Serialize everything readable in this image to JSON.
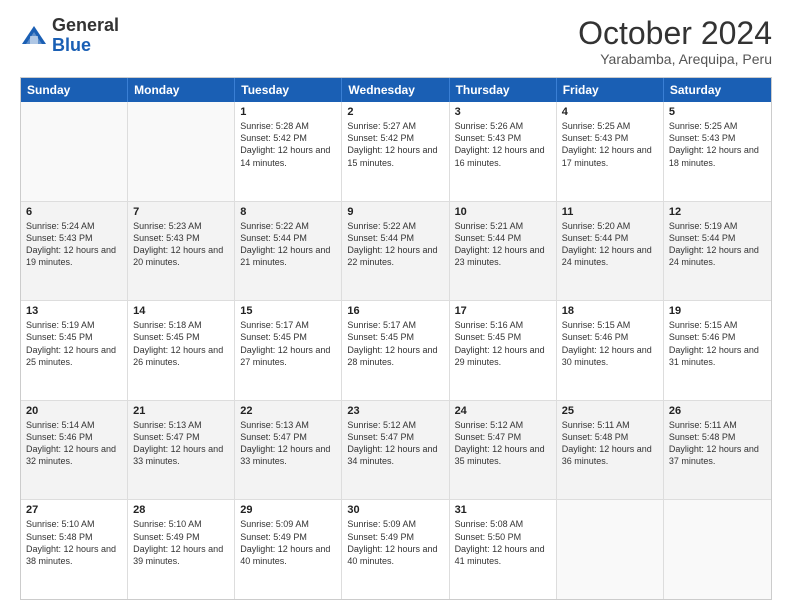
{
  "logo": {
    "general": "General",
    "blue": "Blue"
  },
  "title": "October 2024",
  "subtitle": "Yarabamba, Arequipa, Peru",
  "days": [
    "Sunday",
    "Monday",
    "Tuesday",
    "Wednesday",
    "Thursday",
    "Friday",
    "Saturday"
  ],
  "weeks": [
    [
      {
        "day": "",
        "sunrise": "",
        "sunset": "",
        "daylight": ""
      },
      {
        "day": "",
        "sunrise": "",
        "sunset": "",
        "daylight": ""
      },
      {
        "day": "1",
        "sunrise": "Sunrise: 5:28 AM",
        "sunset": "Sunset: 5:42 PM",
        "daylight": "Daylight: 12 hours and 14 minutes."
      },
      {
        "day": "2",
        "sunrise": "Sunrise: 5:27 AM",
        "sunset": "Sunset: 5:42 PM",
        "daylight": "Daylight: 12 hours and 15 minutes."
      },
      {
        "day": "3",
        "sunrise": "Sunrise: 5:26 AM",
        "sunset": "Sunset: 5:43 PM",
        "daylight": "Daylight: 12 hours and 16 minutes."
      },
      {
        "day": "4",
        "sunrise": "Sunrise: 5:25 AM",
        "sunset": "Sunset: 5:43 PM",
        "daylight": "Daylight: 12 hours and 17 minutes."
      },
      {
        "day": "5",
        "sunrise": "Sunrise: 5:25 AM",
        "sunset": "Sunset: 5:43 PM",
        "daylight": "Daylight: 12 hours and 18 minutes."
      }
    ],
    [
      {
        "day": "6",
        "sunrise": "Sunrise: 5:24 AM",
        "sunset": "Sunset: 5:43 PM",
        "daylight": "Daylight: 12 hours and 19 minutes."
      },
      {
        "day": "7",
        "sunrise": "Sunrise: 5:23 AM",
        "sunset": "Sunset: 5:43 PM",
        "daylight": "Daylight: 12 hours and 20 minutes."
      },
      {
        "day": "8",
        "sunrise": "Sunrise: 5:22 AM",
        "sunset": "Sunset: 5:44 PM",
        "daylight": "Daylight: 12 hours and 21 minutes."
      },
      {
        "day": "9",
        "sunrise": "Sunrise: 5:22 AM",
        "sunset": "Sunset: 5:44 PM",
        "daylight": "Daylight: 12 hours and 22 minutes."
      },
      {
        "day": "10",
        "sunrise": "Sunrise: 5:21 AM",
        "sunset": "Sunset: 5:44 PM",
        "daylight": "Daylight: 12 hours and 23 minutes."
      },
      {
        "day": "11",
        "sunrise": "Sunrise: 5:20 AM",
        "sunset": "Sunset: 5:44 PM",
        "daylight": "Daylight: 12 hours and 24 minutes."
      },
      {
        "day": "12",
        "sunrise": "Sunrise: 5:19 AM",
        "sunset": "Sunset: 5:44 PM",
        "daylight": "Daylight: 12 hours and 24 minutes."
      }
    ],
    [
      {
        "day": "13",
        "sunrise": "Sunrise: 5:19 AM",
        "sunset": "Sunset: 5:45 PM",
        "daylight": "Daylight: 12 hours and 25 minutes."
      },
      {
        "day": "14",
        "sunrise": "Sunrise: 5:18 AM",
        "sunset": "Sunset: 5:45 PM",
        "daylight": "Daylight: 12 hours and 26 minutes."
      },
      {
        "day": "15",
        "sunrise": "Sunrise: 5:17 AM",
        "sunset": "Sunset: 5:45 PM",
        "daylight": "Daylight: 12 hours and 27 minutes."
      },
      {
        "day": "16",
        "sunrise": "Sunrise: 5:17 AM",
        "sunset": "Sunset: 5:45 PM",
        "daylight": "Daylight: 12 hours and 28 minutes."
      },
      {
        "day": "17",
        "sunrise": "Sunrise: 5:16 AM",
        "sunset": "Sunset: 5:45 PM",
        "daylight": "Daylight: 12 hours and 29 minutes."
      },
      {
        "day": "18",
        "sunrise": "Sunrise: 5:15 AM",
        "sunset": "Sunset: 5:46 PM",
        "daylight": "Daylight: 12 hours and 30 minutes."
      },
      {
        "day": "19",
        "sunrise": "Sunrise: 5:15 AM",
        "sunset": "Sunset: 5:46 PM",
        "daylight": "Daylight: 12 hours and 31 minutes."
      }
    ],
    [
      {
        "day": "20",
        "sunrise": "Sunrise: 5:14 AM",
        "sunset": "Sunset: 5:46 PM",
        "daylight": "Daylight: 12 hours and 32 minutes."
      },
      {
        "day": "21",
        "sunrise": "Sunrise: 5:13 AM",
        "sunset": "Sunset: 5:47 PM",
        "daylight": "Daylight: 12 hours and 33 minutes."
      },
      {
        "day": "22",
        "sunrise": "Sunrise: 5:13 AM",
        "sunset": "Sunset: 5:47 PM",
        "daylight": "Daylight: 12 hours and 33 minutes."
      },
      {
        "day": "23",
        "sunrise": "Sunrise: 5:12 AM",
        "sunset": "Sunset: 5:47 PM",
        "daylight": "Daylight: 12 hours and 34 minutes."
      },
      {
        "day": "24",
        "sunrise": "Sunrise: 5:12 AM",
        "sunset": "Sunset: 5:47 PM",
        "daylight": "Daylight: 12 hours and 35 minutes."
      },
      {
        "day": "25",
        "sunrise": "Sunrise: 5:11 AM",
        "sunset": "Sunset: 5:48 PM",
        "daylight": "Daylight: 12 hours and 36 minutes."
      },
      {
        "day": "26",
        "sunrise": "Sunrise: 5:11 AM",
        "sunset": "Sunset: 5:48 PM",
        "daylight": "Daylight: 12 hours and 37 minutes."
      }
    ],
    [
      {
        "day": "27",
        "sunrise": "Sunrise: 5:10 AM",
        "sunset": "Sunset: 5:48 PM",
        "daylight": "Daylight: 12 hours and 38 minutes."
      },
      {
        "day": "28",
        "sunrise": "Sunrise: 5:10 AM",
        "sunset": "Sunset: 5:49 PM",
        "daylight": "Daylight: 12 hours and 39 minutes."
      },
      {
        "day": "29",
        "sunrise": "Sunrise: 5:09 AM",
        "sunset": "Sunset: 5:49 PM",
        "daylight": "Daylight: 12 hours and 40 minutes."
      },
      {
        "day": "30",
        "sunrise": "Sunrise: 5:09 AM",
        "sunset": "Sunset: 5:49 PM",
        "daylight": "Daylight: 12 hours and 40 minutes."
      },
      {
        "day": "31",
        "sunrise": "Sunrise: 5:08 AM",
        "sunset": "Sunset: 5:50 PM",
        "daylight": "Daylight: 12 hours and 41 minutes."
      },
      {
        "day": "",
        "sunrise": "",
        "sunset": "",
        "daylight": ""
      },
      {
        "day": "",
        "sunrise": "",
        "sunset": "",
        "daylight": ""
      }
    ]
  ]
}
